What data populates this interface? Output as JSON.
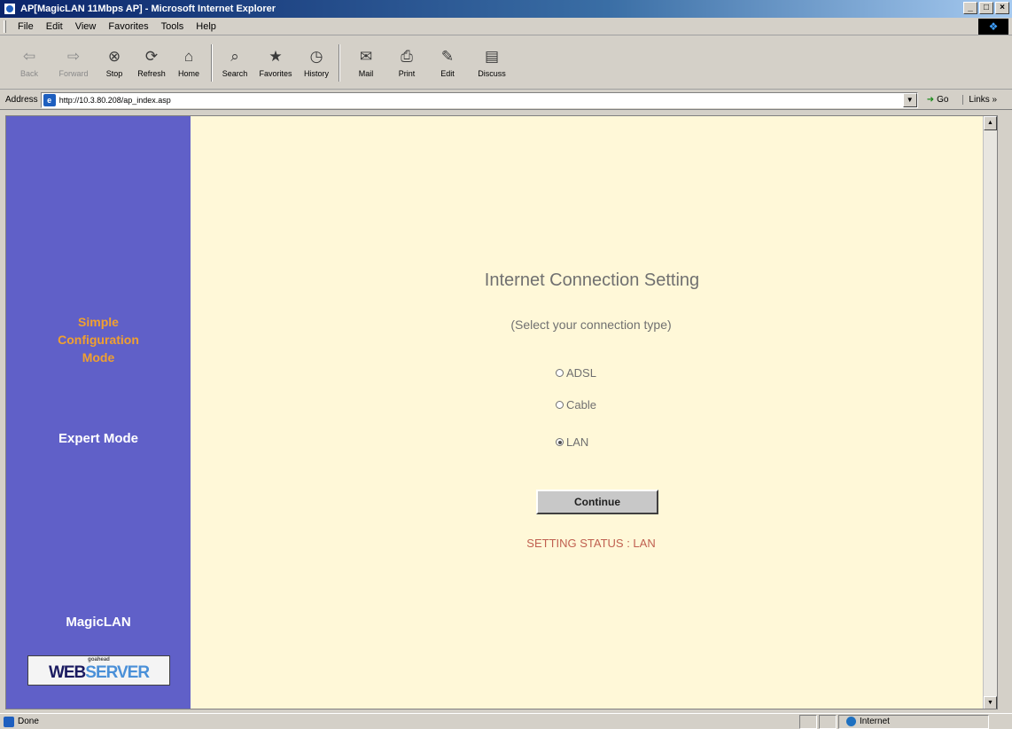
{
  "window": {
    "title": "AP[MagicLAN 11Mbps AP] - Microsoft Internet Explorer",
    "min_glyph": "_",
    "max_glyph": "□",
    "close_glyph": "×"
  },
  "menu": [
    "File",
    "Edit",
    "View",
    "Favorites",
    "Tools",
    "Help"
  ],
  "toolbar": {
    "back": "Back",
    "forward": "Forward",
    "stop": "Stop",
    "refresh": "Refresh",
    "home": "Home",
    "search": "Search",
    "favorites": "Favorites",
    "history": "History",
    "mail": "Mail",
    "print": "Print",
    "edit": "Edit",
    "discuss": "Discuss"
  },
  "address": {
    "label": "Address",
    "url": "http://10.3.80.208/ap_index.asp",
    "go": "Go",
    "links": "Links »"
  },
  "sidebar": {
    "simple_line1": "Simple",
    "simple_line2": "Configuration",
    "simple_line3": "Mode",
    "expert": "Expert Mode",
    "brand": "MagicLAN",
    "logo_top": "goahead",
    "logo_web": "WEB",
    "logo_server": "SERVER"
  },
  "main": {
    "title": "Internet Connection Setting",
    "subtitle": "(Select your connection type)",
    "options": [
      {
        "label": "ADSL",
        "checked": false
      },
      {
        "label": "Cable",
        "checked": false
      },
      {
        "label": "LAN",
        "checked": true
      }
    ],
    "continue": "Continue",
    "status": "SETTING STATUS : LAN"
  },
  "statusbar": {
    "text": "Done",
    "zone": "Internet"
  },
  "colors": {
    "sidebar_bg": "#6060c8",
    "main_bg": "#fff8d8",
    "simple_mode": "#f0a030",
    "status_text": "#c06050"
  }
}
